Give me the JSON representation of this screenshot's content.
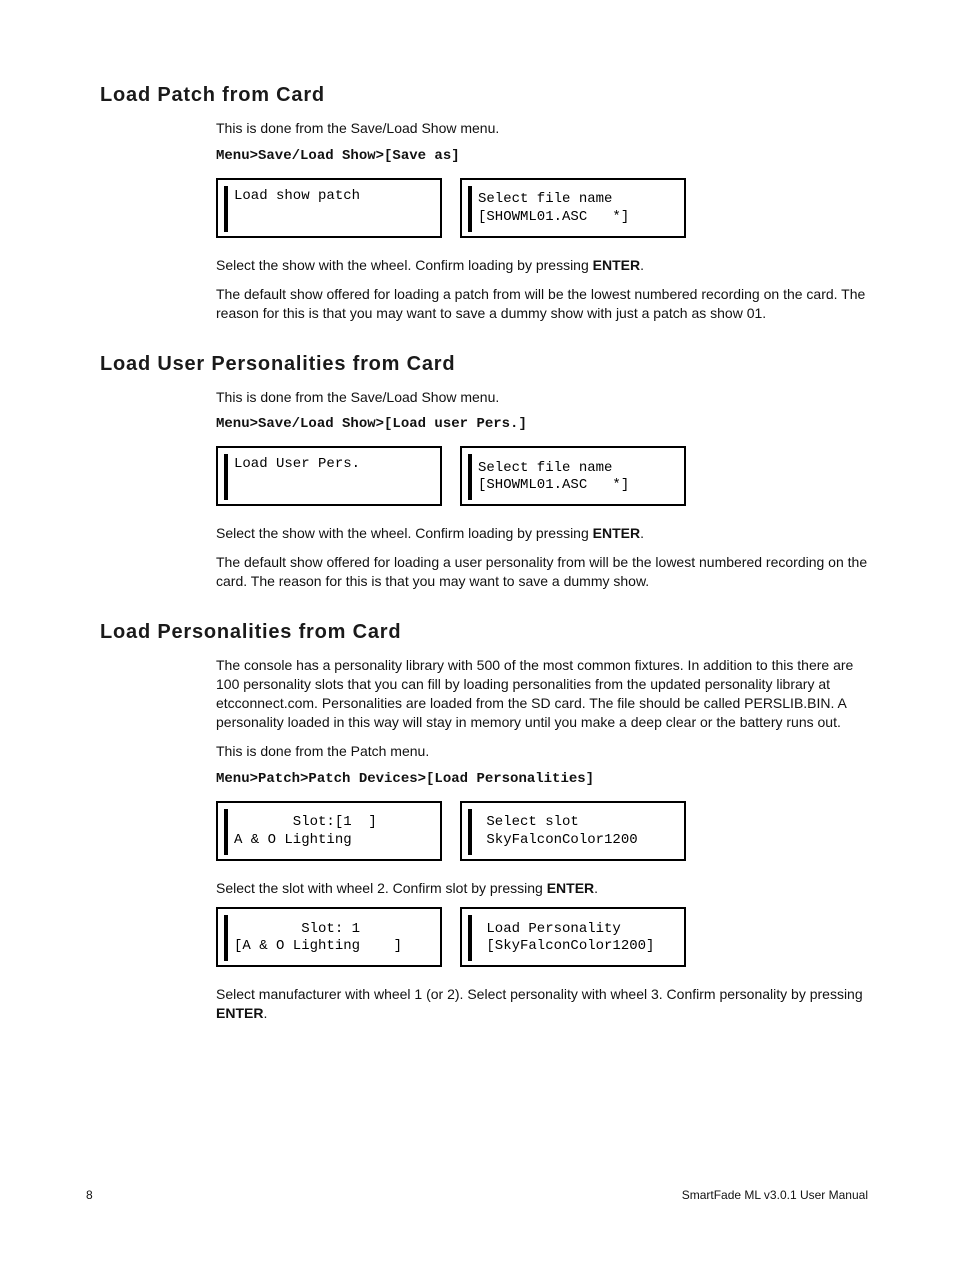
{
  "sections": {
    "loadPatch": {
      "heading": "Load Patch from Card",
      "intro": "This is done from the Save/Load Show menu.",
      "menu": "Menu>Save/Load Show>[Save as]",
      "screen1_l1": "Load show patch",
      "screen1_l2": "",
      "screen2_l1": "Select file name",
      "screen2_l2": "[SHOWML01.ASC   *]",
      "para1_pre": "Select the show with the wheel. Confirm loading by pressing ",
      "para1_bold": "ENTER",
      "para1_post": ".",
      "para2": "The default show offered for loading a patch from will be the lowest numbered recording on the card. The reason for this is that you may want to save a dummy show with just a patch as show 01."
    },
    "loadUserPers": {
      "heading": "Load User Personalities from Card",
      "intro": "This is done from the Save/Load Show menu.",
      "menu": "Menu>Save/Load Show>[Load user Pers.]",
      "screen1_l1": "Load User Pers.",
      "screen1_l2": "",
      "screen2_l1": "Select file name",
      "screen2_l2": "[SHOWML01.ASC   *]",
      "para1_pre": "Select the show with the wheel. Confirm loading by pressing ",
      "para1_bold": "ENTER",
      "para1_post": ".",
      "para2": "The default show offered for loading a user personality from will be the lowest numbered recording on the card. The reason for this is that you may want to save a dummy show."
    },
    "loadPers": {
      "heading": "Load Personalities from Card",
      "para1": "The console has a personality library with 500 of the most common fixtures. In addition to this there are 100 personality slots that you can fill by loading personalities from the updated personality library at etcconnect.com. Personalities are loaded from the SD card. The file should be called PERSLIB.BIN. A personality loaded in this way will stay in memory until you make a deep clear or the battery runs out.",
      "intro2": "This is done from the Patch menu.",
      "menu": "Menu>Patch>Patch Devices>[Load Personalities]",
      "rowA_s1_l1": "       Slot:[1  ]",
      "rowA_s1_l2": "A & O Lighting",
      "rowA_s2_l1": " Select slot",
      "rowA_s2_l2": " SkyFalconColor1200",
      "paraA_pre": "Select the slot with wheel 2. Confirm slot by pressing ",
      "paraA_bold": "ENTER",
      "paraA_post": ".",
      "rowB_s1_l1": "        Slot: 1",
      "rowB_s1_l2": "[A & O Lighting    ]",
      "rowB_s2_l1": " Load Personality",
      "rowB_s2_l2": " [SkyFalconColor1200]",
      "paraB_pre": "Select manufacturer with wheel 1 (or 2). Select personality with wheel 3. Confirm personality by pressing ",
      "paraB_bold": "ENTER",
      "paraB_post": "."
    }
  },
  "footer": {
    "page": "8",
    "title": "SmartFade ML v3.0.1 User Manual"
  }
}
